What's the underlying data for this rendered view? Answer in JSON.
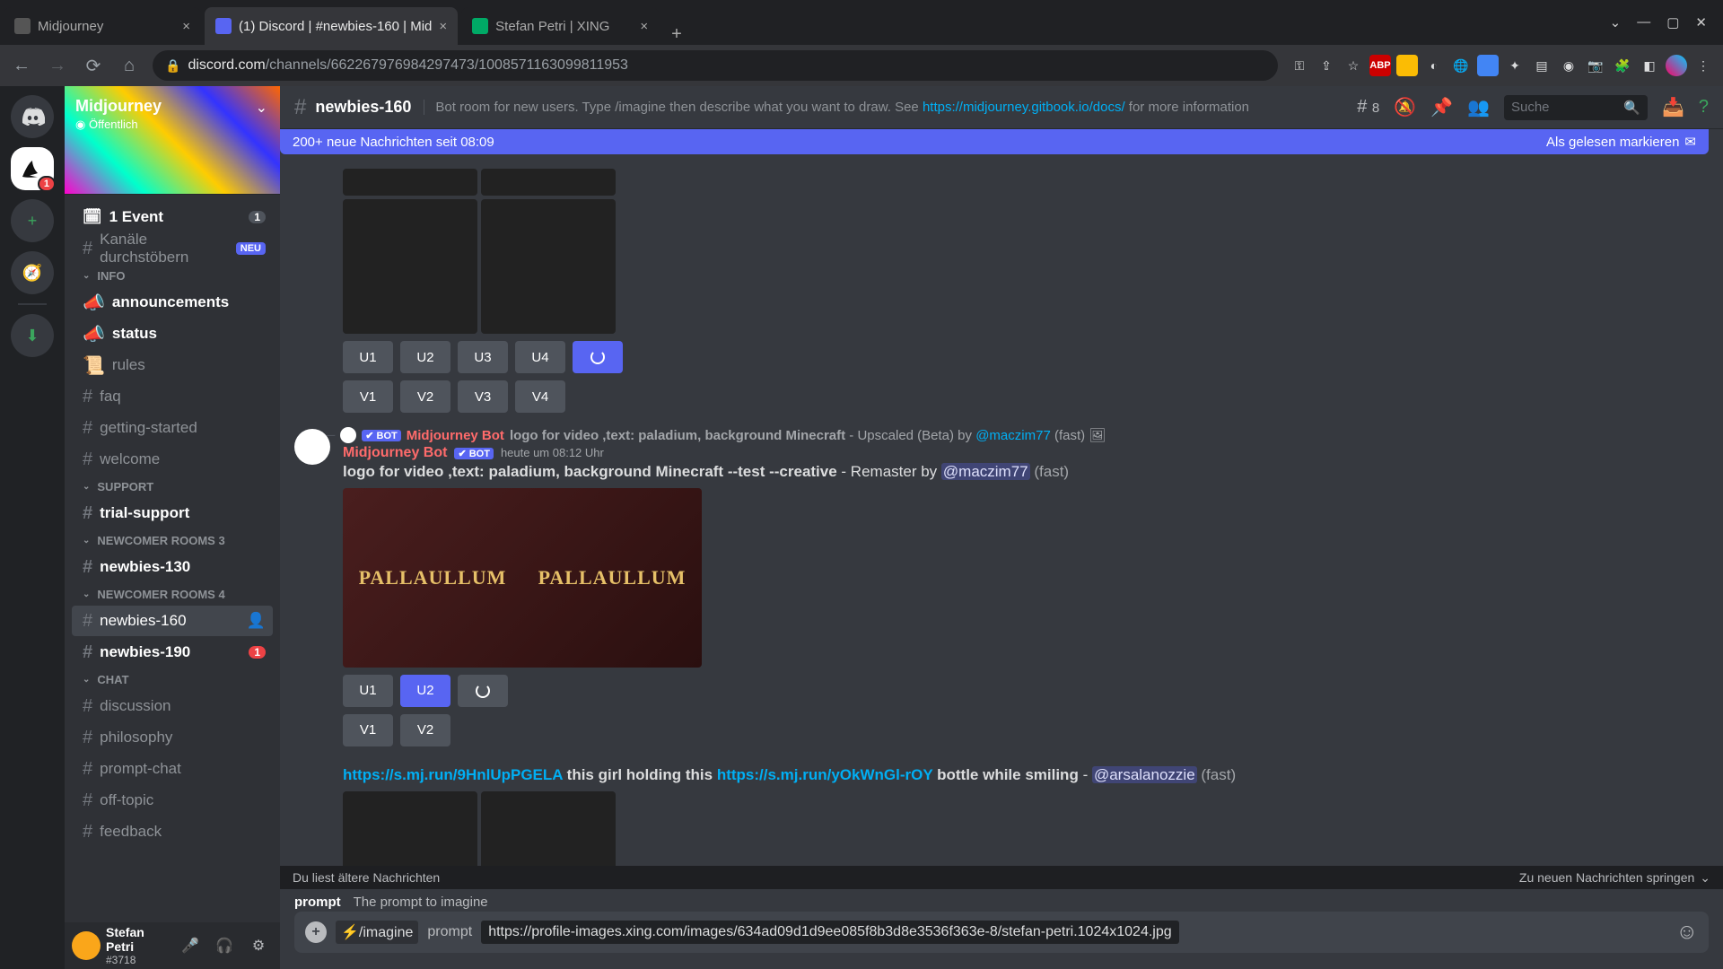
{
  "browser": {
    "tabs": [
      {
        "title": "Midjourney"
      },
      {
        "title": "(1) Discord | #newbies-160 | Mid"
      },
      {
        "title": "Stefan Petri | XING"
      }
    ],
    "url_domain": "discord.com",
    "url_path": "/channels/662267976984297473/1008571163099811953"
  },
  "server": {
    "name": "Midjourney",
    "public": "Öffentlich"
  },
  "serverRailBadge": "1",
  "sidebar": {
    "event": "1 Event",
    "event_badge": "1",
    "browse": "Kanäle durchstöbern",
    "browse_badge": "NEU",
    "categories": {
      "info": "INFO",
      "support": "SUPPORT",
      "new3": "NEWCOMER ROOMS 3",
      "new4": "NEWCOMER ROOMS 4",
      "chat": "CHAT"
    },
    "channels": {
      "announcements": "announcements",
      "status": "status",
      "rules": "rules",
      "faq": "faq",
      "getting_started": "getting-started",
      "welcome": "welcome",
      "trial_support": "trial-support",
      "newbies130": "newbies-130",
      "newbies160": "newbies-160",
      "newbies190": "newbies-190",
      "newbies190_badge": "1",
      "discussion": "discussion",
      "philosophy": "philosophy",
      "prompt_chat": "prompt-chat",
      "off_topic": "off-topic",
      "feedback": "feedback"
    }
  },
  "user": {
    "name": "Stefan Petri",
    "tag": "#3718"
  },
  "header": {
    "channel": "newbies-160",
    "topic_pre": "Bot room for new users. Type /imagine then describe what you want to draw. See ",
    "topic_link": "https://midjourney.gitbook.io/docs/",
    "topic_post": " for more information",
    "threads": "8",
    "search_placeholder": "Suche"
  },
  "bars": {
    "new_msgs": "200+ neue Nachrichten seit 08:09",
    "mark_read": "Als gelesen markieren",
    "older": "Du liest ältere Nachrichten",
    "jump": "Zu neuen Nachrichten springen"
  },
  "msg1": {
    "buttons_u": [
      "U1",
      "U2",
      "U3",
      "U4"
    ],
    "buttons_v": [
      "V1",
      "V2",
      "V3",
      "V4"
    ]
  },
  "msg2": {
    "reply_author": "Midjourney Bot",
    "reply_bot": "✔ BOT",
    "reply_text": "logo for video ,text: paladium, background Minecraft",
    "reply_suffix": " - Upscaled (Beta) by ",
    "reply_mention": "@maczim77",
    "reply_fast": " (fast)",
    "author": "Midjourney Bot",
    "bot": "✔ BOT",
    "time": "heute um 08:12 Uhr",
    "text_bold": "logo for video ,text: paladium, background Minecraft --test --creative",
    "text_suffix": " - Remaster by ",
    "text_mention": "@maczim77",
    "text_fast": " (fast)",
    "img_label": "PALLAULLUM",
    "btns_u": [
      "U1",
      "U2"
    ],
    "btns_v": [
      "V1",
      "V2"
    ]
  },
  "msg3": {
    "link1": "https://s.mj.run/9HnlUpPGELA",
    "mid1": " this girl holding this ",
    "link2": "https://s.mj.run/yOkWnGl-rOY",
    "mid2": " bottle while smiling",
    "dash": " - ",
    "mention": "@arsalanozzie",
    "fast": " (fast)"
  },
  "prompt_help": {
    "name": "prompt",
    "desc": "The prompt to imagine"
  },
  "input": {
    "cmd": "/imagine",
    "opt": "prompt",
    "val": "https://profile-images.xing.com/images/634ad09d1d9ee085f8b3d8e3536f363e-8/stefan-petri.1024x1024.jpg"
  }
}
